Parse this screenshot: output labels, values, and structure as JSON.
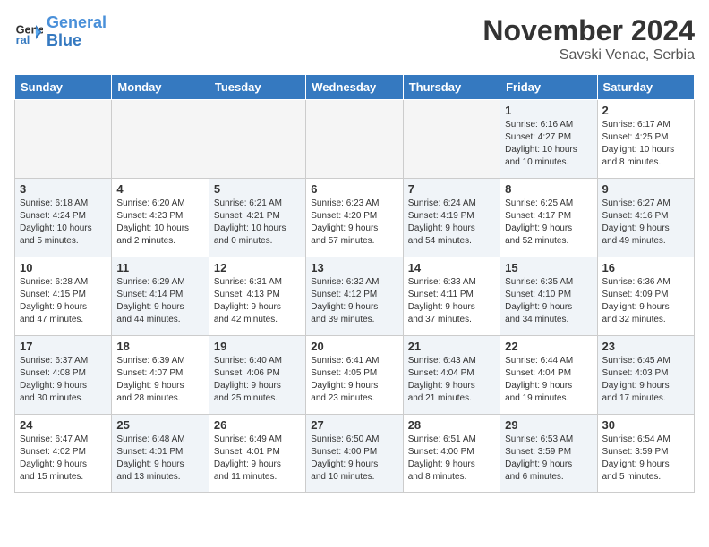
{
  "header": {
    "logo_line1": "General",
    "logo_line2": "Blue",
    "month_year": "November 2024",
    "location": "Savski Venac, Serbia"
  },
  "days_of_week": [
    "Sunday",
    "Monday",
    "Tuesday",
    "Wednesday",
    "Thursday",
    "Friday",
    "Saturday"
  ],
  "weeks": [
    [
      {
        "day": "",
        "info": "",
        "empty": true
      },
      {
        "day": "",
        "info": "",
        "empty": true
      },
      {
        "day": "",
        "info": "",
        "empty": true
      },
      {
        "day": "",
        "info": "",
        "empty": true
      },
      {
        "day": "",
        "info": "",
        "empty": true
      },
      {
        "day": "1",
        "info": "Sunrise: 6:16 AM\nSunset: 4:27 PM\nDaylight: 10 hours\nand 10 minutes.",
        "empty": false,
        "shaded": true
      },
      {
        "day": "2",
        "info": "Sunrise: 6:17 AM\nSunset: 4:25 PM\nDaylight: 10 hours\nand 8 minutes.",
        "empty": false,
        "shaded": false
      }
    ],
    [
      {
        "day": "3",
        "info": "Sunrise: 6:18 AM\nSunset: 4:24 PM\nDaylight: 10 hours\nand 5 minutes.",
        "empty": false,
        "shaded": true
      },
      {
        "day": "4",
        "info": "Sunrise: 6:20 AM\nSunset: 4:23 PM\nDaylight: 10 hours\nand 2 minutes.",
        "empty": false,
        "shaded": false
      },
      {
        "day": "5",
        "info": "Sunrise: 6:21 AM\nSunset: 4:21 PM\nDaylight: 10 hours\nand 0 minutes.",
        "empty": false,
        "shaded": true
      },
      {
        "day": "6",
        "info": "Sunrise: 6:23 AM\nSunset: 4:20 PM\nDaylight: 9 hours\nand 57 minutes.",
        "empty": false,
        "shaded": false
      },
      {
        "day": "7",
        "info": "Sunrise: 6:24 AM\nSunset: 4:19 PM\nDaylight: 9 hours\nand 54 minutes.",
        "empty": false,
        "shaded": true
      },
      {
        "day": "8",
        "info": "Sunrise: 6:25 AM\nSunset: 4:17 PM\nDaylight: 9 hours\nand 52 minutes.",
        "empty": false,
        "shaded": false
      },
      {
        "day": "9",
        "info": "Sunrise: 6:27 AM\nSunset: 4:16 PM\nDaylight: 9 hours\nand 49 minutes.",
        "empty": false,
        "shaded": true
      }
    ],
    [
      {
        "day": "10",
        "info": "Sunrise: 6:28 AM\nSunset: 4:15 PM\nDaylight: 9 hours\nand 47 minutes.",
        "empty": false,
        "shaded": false
      },
      {
        "day": "11",
        "info": "Sunrise: 6:29 AM\nSunset: 4:14 PM\nDaylight: 9 hours\nand 44 minutes.",
        "empty": false,
        "shaded": true
      },
      {
        "day": "12",
        "info": "Sunrise: 6:31 AM\nSunset: 4:13 PM\nDaylight: 9 hours\nand 42 minutes.",
        "empty": false,
        "shaded": false
      },
      {
        "day": "13",
        "info": "Sunrise: 6:32 AM\nSunset: 4:12 PM\nDaylight: 9 hours\nand 39 minutes.",
        "empty": false,
        "shaded": true
      },
      {
        "day": "14",
        "info": "Sunrise: 6:33 AM\nSunset: 4:11 PM\nDaylight: 9 hours\nand 37 minutes.",
        "empty": false,
        "shaded": false
      },
      {
        "day": "15",
        "info": "Sunrise: 6:35 AM\nSunset: 4:10 PM\nDaylight: 9 hours\nand 34 minutes.",
        "empty": false,
        "shaded": true
      },
      {
        "day": "16",
        "info": "Sunrise: 6:36 AM\nSunset: 4:09 PM\nDaylight: 9 hours\nand 32 minutes.",
        "empty": false,
        "shaded": false
      }
    ],
    [
      {
        "day": "17",
        "info": "Sunrise: 6:37 AM\nSunset: 4:08 PM\nDaylight: 9 hours\nand 30 minutes.",
        "empty": false,
        "shaded": true
      },
      {
        "day": "18",
        "info": "Sunrise: 6:39 AM\nSunset: 4:07 PM\nDaylight: 9 hours\nand 28 minutes.",
        "empty": false,
        "shaded": false
      },
      {
        "day": "19",
        "info": "Sunrise: 6:40 AM\nSunset: 4:06 PM\nDaylight: 9 hours\nand 25 minutes.",
        "empty": false,
        "shaded": true
      },
      {
        "day": "20",
        "info": "Sunrise: 6:41 AM\nSunset: 4:05 PM\nDaylight: 9 hours\nand 23 minutes.",
        "empty": false,
        "shaded": false
      },
      {
        "day": "21",
        "info": "Sunrise: 6:43 AM\nSunset: 4:04 PM\nDaylight: 9 hours\nand 21 minutes.",
        "empty": false,
        "shaded": true
      },
      {
        "day": "22",
        "info": "Sunrise: 6:44 AM\nSunset: 4:04 PM\nDaylight: 9 hours\nand 19 minutes.",
        "empty": false,
        "shaded": false
      },
      {
        "day": "23",
        "info": "Sunrise: 6:45 AM\nSunset: 4:03 PM\nDaylight: 9 hours\nand 17 minutes.",
        "empty": false,
        "shaded": true
      }
    ],
    [
      {
        "day": "24",
        "info": "Sunrise: 6:47 AM\nSunset: 4:02 PM\nDaylight: 9 hours\nand 15 minutes.",
        "empty": false,
        "shaded": false
      },
      {
        "day": "25",
        "info": "Sunrise: 6:48 AM\nSunset: 4:01 PM\nDaylight: 9 hours\nand 13 minutes.",
        "empty": false,
        "shaded": true
      },
      {
        "day": "26",
        "info": "Sunrise: 6:49 AM\nSunset: 4:01 PM\nDaylight: 9 hours\nand 11 minutes.",
        "empty": false,
        "shaded": false
      },
      {
        "day": "27",
        "info": "Sunrise: 6:50 AM\nSunset: 4:00 PM\nDaylight: 9 hours\nand 10 minutes.",
        "empty": false,
        "shaded": true
      },
      {
        "day": "28",
        "info": "Sunrise: 6:51 AM\nSunset: 4:00 PM\nDaylight: 9 hours\nand 8 minutes.",
        "empty": false,
        "shaded": false
      },
      {
        "day": "29",
        "info": "Sunrise: 6:53 AM\nSunset: 3:59 PM\nDaylight: 9 hours\nand 6 minutes.",
        "empty": false,
        "shaded": true
      },
      {
        "day": "30",
        "info": "Sunrise: 6:54 AM\nSunset: 3:59 PM\nDaylight: 9 hours\nand 5 minutes.",
        "empty": false,
        "shaded": false
      }
    ]
  ]
}
